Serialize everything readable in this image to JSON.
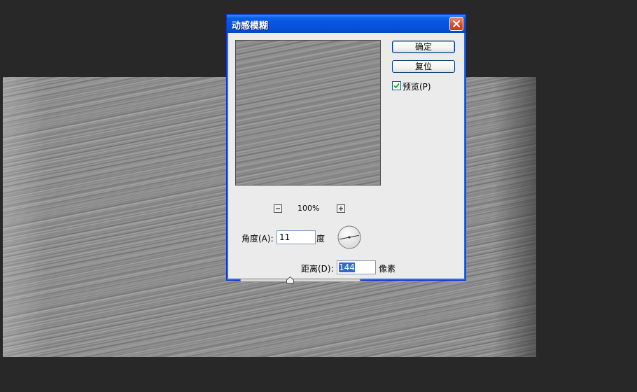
{
  "dialog": {
    "title": "动感模糊",
    "ok_label": "确定",
    "reset_label": "复位",
    "preview_label": "预览(P)",
    "preview_checked": true,
    "zoom_value": "100%",
    "angle_label": "角度(A):",
    "angle_value": "11",
    "angle_unit": "度",
    "distance_label": "距离(D):",
    "distance_value": "144",
    "distance_unit": "像素",
    "distance_slider_fraction": 0.42
  },
  "icons": {
    "close": "close-icon",
    "zoom_out": "minus-icon",
    "zoom_in": "plus-icon",
    "check": "check-icon",
    "angle_dial": "angle-dial-icon",
    "slider_thumb": "slider-thumb-icon"
  },
  "colors": {
    "titlebar": "#0653e0",
    "close_button": "#d4492a",
    "selection": "#316ac5",
    "workspace": "#282828"
  }
}
